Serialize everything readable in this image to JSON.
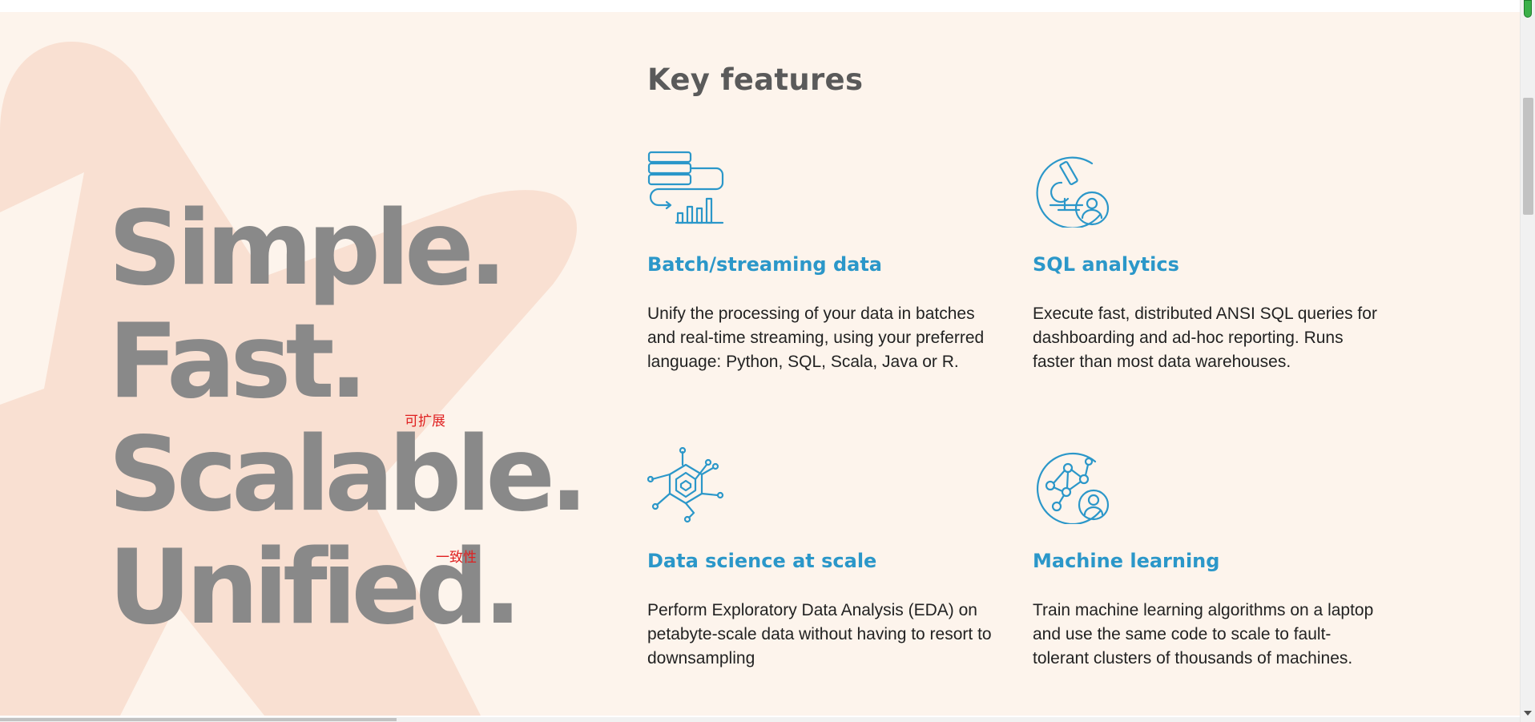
{
  "hero": {
    "words": [
      "Simple.",
      "Fast.",
      "Scalable.",
      "Unified."
    ],
    "annotations": {
      "scalable": "可扩展",
      "unified": "一致性"
    }
  },
  "features_heading": "Key features",
  "features": [
    {
      "icon": "data-pipeline-icon",
      "title": "Batch/streaming data",
      "description": "Unify the processing of your data in batches and real-time streaming, using your preferred language: Python, SQL, Scala, Java or R."
    },
    {
      "icon": "microscope-user-icon",
      "title": "SQL analytics",
      "description": "Execute fast, distributed ANSI SQL queries for dashboarding and ad-hoc reporting. Runs faster than most data warehouses."
    },
    {
      "icon": "circuit-hexagon-icon",
      "title": "Data science at scale",
      "description": "Perform Exploratory Data Analysis (EDA) on petabyte-scale data without having to resort to downsampling"
    },
    {
      "icon": "network-user-icon",
      "title": "Machine learning",
      "description": "Train machine learning algorithms on a laptop and use the same code to scale to fault-tolerant clusters of thousands of machines."
    }
  ],
  "colors": {
    "section_background": "#fdf4ec",
    "background_star": "#f9e0d2",
    "hero_text": "#898989",
    "heading_text": "#5a5a5a",
    "feature_accent": "#2b97c9",
    "body_text": "#222222",
    "annotation": "#e02020"
  }
}
